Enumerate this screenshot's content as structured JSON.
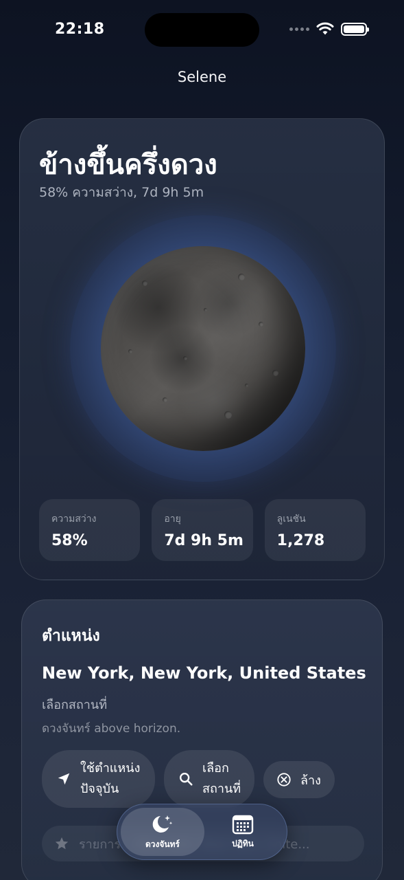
{
  "status_bar": {
    "time": "22:18"
  },
  "nav": {
    "title": "Selene"
  },
  "phase": {
    "name": "ข้างขึ้นครึ่งดวง",
    "summary": "58% ความสว่าง, 7d 9h 5m",
    "stats": [
      {
        "label": "ความสว่าง",
        "value": "58%"
      },
      {
        "label": "อายุ",
        "value": "7d 9h 5m"
      },
      {
        "label": "ลูเนชัน",
        "value": "1,278"
      }
    ]
  },
  "location": {
    "header": "ตำแหน่ง",
    "city": "New York, New York, United States",
    "choose_hint": "เลือกสถานที่",
    "horizon_status": "ดวงจันทร์ above horizon.",
    "use_current_label_line1": "ใช้ตำแหน่ง",
    "use_current_label_line2": "ปัจจุบัน",
    "pick_place_label_line1": "เลือก",
    "pick_place_label_line2": "สถานที่",
    "clear_label": "ล้าง",
    "favorite_text": "รายการ... New York, New York, Unite..."
  },
  "tabs": [
    {
      "label": "ดวงจันทร์",
      "icon": "moon-stars-icon",
      "selected": true
    },
    {
      "label": "ปฏิทิน",
      "icon": "calendar-icon",
      "selected": false
    }
  ]
}
